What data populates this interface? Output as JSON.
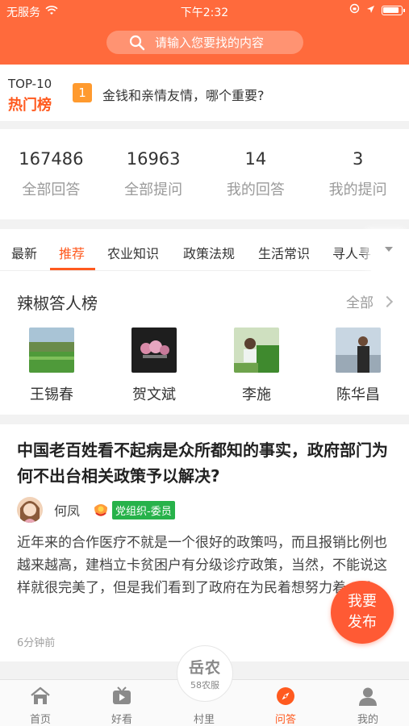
{
  "status_bar": {
    "carrier": "无服务",
    "time": "下午2:32"
  },
  "search": {
    "placeholder": "请输入您要找的内容"
  },
  "hot": {
    "top_label": "TOP-10",
    "title": "热门榜",
    "rank": "1",
    "question": "金钱和亲情友情，哪个重要?"
  },
  "stats": [
    {
      "value": "167486",
      "label": "全部回答"
    },
    {
      "value": "16963",
      "label": "全部提问"
    },
    {
      "value": "14",
      "label": "我的回答"
    },
    {
      "value": "3",
      "label": "我的提问"
    }
  ],
  "tabs": [
    "最新",
    "推荐",
    "农业知识",
    "政策法规",
    "生活常识",
    "寻人寻"
  ],
  "active_tab": "推荐",
  "ranklist": {
    "title": "辣椒答人榜",
    "all_label": "全部",
    "people": [
      {
        "name": "王锡春"
      },
      {
        "name": "贺文斌"
      },
      {
        "name": "李施"
      },
      {
        "name": "陈华昌"
      }
    ]
  },
  "post": {
    "title": "中国老百姓看不起病是众所都知的事实，政府部门为何不出台相关政策予以解决?",
    "author": "何凤",
    "badge": "党组织-委员",
    "body": "近年来的合作医疗不就是一个很好的政策吗，而且报销比例也越来越高，建档立卡贫困户有分级诊疗政策，当然，不能说这样就很完美了，但是我们看到了政府在为民着想努力着，凡",
    "time": "6分钟前"
  },
  "fab": {
    "line1": "我要",
    "line2": "发布"
  },
  "tabbar": {
    "items": [
      {
        "label": "首页",
        "icon": "home-icon"
      },
      {
        "label": "好看",
        "icon": "tv-icon"
      },
      {
        "label": "村里",
        "icon": "village-icon"
      },
      {
        "label": "问答",
        "icon": "compass-icon"
      },
      {
        "label": "我的",
        "icon": "user-icon"
      }
    ],
    "center_logo": "岳农",
    "center_sub": "58农服"
  },
  "colors": {
    "brand": "#ff6a3c",
    "accent": "#ff5a1f",
    "badge": "#27b24a"
  }
}
